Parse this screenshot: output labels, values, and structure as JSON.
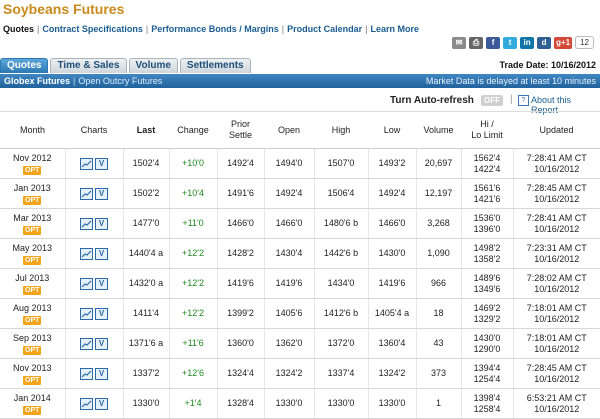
{
  "title": "Soybeans Futures",
  "nav": {
    "quotes": "Quotes",
    "contract_specs": "Contract Specifications",
    "performance": "Performance Bonds / Margins",
    "calendar": "Product Calendar",
    "learn": "Learn More"
  },
  "share": {
    "count": "12",
    "icons": [
      "email-icon",
      "print-icon",
      "facebook-icon",
      "twitter-icon",
      "linkedin-icon",
      "digg-icon",
      "google-plus-icon"
    ]
  },
  "tabs": [
    "Quotes",
    "Time & Sales",
    "Volume",
    "Settlements"
  ],
  "trade_date": "Trade Date: 10/16/2012",
  "market_bar": {
    "globex": "Globex Futures",
    "open_outcry": "Open Outcry Futures",
    "delay": "Market Data is delayed at least 10 minutes"
  },
  "auto_refresh": {
    "label": "Turn Auto-refresh",
    "state": "OFF",
    "about": "About this Report"
  },
  "headers": {
    "month": "Month",
    "charts": "Charts",
    "last": "Last",
    "change": "Change",
    "prior_settle_1": "Prior",
    "prior_settle_2": "Settle",
    "open": "Open",
    "high": "High",
    "low": "Low",
    "volume": "Volume",
    "limit_1": "Hi /",
    "limit_2": "Lo Limit",
    "updated": "Updated"
  },
  "opt_label": "OPT",
  "rows": [
    {
      "month": "Nov 2012",
      "last": "1502'4",
      "change": "+10'0",
      "prior": "1492'4",
      "open": "1494'0",
      "high": "1507'0",
      "low": "1493'2",
      "volume": "20,697",
      "hi": "1562'4",
      "lo": "1422'4",
      "time": "7:28:41 AM CT",
      "date": "10/16/2012"
    },
    {
      "month": "Jan 2013",
      "last": "1502'2",
      "change": "+10'4",
      "prior": "1491'6",
      "open": "1492'4",
      "high": "1506'4",
      "low": "1492'4",
      "volume": "12,197",
      "hi": "1561'6",
      "lo": "1421'6",
      "time": "7:28:45 AM CT",
      "date": "10/16/2012"
    },
    {
      "month": "Mar 2013",
      "last": "1477'0",
      "change": "+11'0",
      "prior": "1466'0",
      "open": "1466'0",
      "high": "1480'6 b",
      "low": "1466'0",
      "volume": "3,268",
      "hi": "1536'0",
      "lo": "1396'0",
      "time": "7:28:41 AM CT",
      "date": "10/16/2012"
    },
    {
      "month": "May 2013",
      "last": "1440'4 a",
      "change": "+12'2",
      "prior": "1428'2",
      "open": "1430'4",
      "high": "1442'6 b",
      "low": "1430'0",
      "volume": "1,090",
      "hi": "1498'2",
      "lo": "1358'2",
      "time": "7:23:31 AM CT",
      "date": "10/16/2012"
    },
    {
      "month": "Jul 2013",
      "last": "1432'0 a",
      "change": "+12'2",
      "prior": "1419'6",
      "open": "1419'6",
      "high": "1434'0",
      "low": "1419'6",
      "volume": "966",
      "hi": "1489'6",
      "lo": "1349'6",
      "time": "7:28:02 AM CT",
      "date": "10/16/2012"
    },
    {
      "month": "Aug 2013",
      "last": "1411'4",
      "change": "+12'2",
      "prior": "1399'2",
      "open": "1405'6",
      "high": "1412'6 b",
      "low": "1405'4 a",
      "volume": "18",
      "hi": "1469'2",
      "lo": "1329'2",
      "time": "7:18:01 AM CT",
      "date": "10/16/2012"
    },
    {
      "month": "Sep 2013",
      "last": "1371'6 a",
      "change": "+11'6",
      "prior": "1360'0",
      "open": "1362'0",
      "high": "1372'0",
      "low": "1360'4",
      "volume": "43",
      "hi": "1430'0",
      "lo": "1290'0",
      "time": "7:18:01 AM CT",
      "date": "10/16/2012"
    },
    {
      "month": "Nov 2013",
      "last": "1337'2",
      "change": "+12'6",
      "prior": "1324'4",
      "open": "1324'2",
      "high": "1337'4",
      "low": "1324'2",
      "volume": "373",
      "hi": "1394'4",
      "lo": "1254'4",
      "time": "7:28:45 AM CT",
      "date": "10/16/2012"
    },
    {
      "month": "Jan 2014",
      "last": "1330'0",
      "change": "+1'4",
      "prior": "1328'4",
      "open": "1330'0",
      "high": "1330'0",
      "low": "1330'0",
      "volume": "1",
      "hi": "1398'4",
      "lo": "1258'4",
      "time": "6:53:21 AM CT",
      "date": "10/16/2012"
    }
  ]
}
